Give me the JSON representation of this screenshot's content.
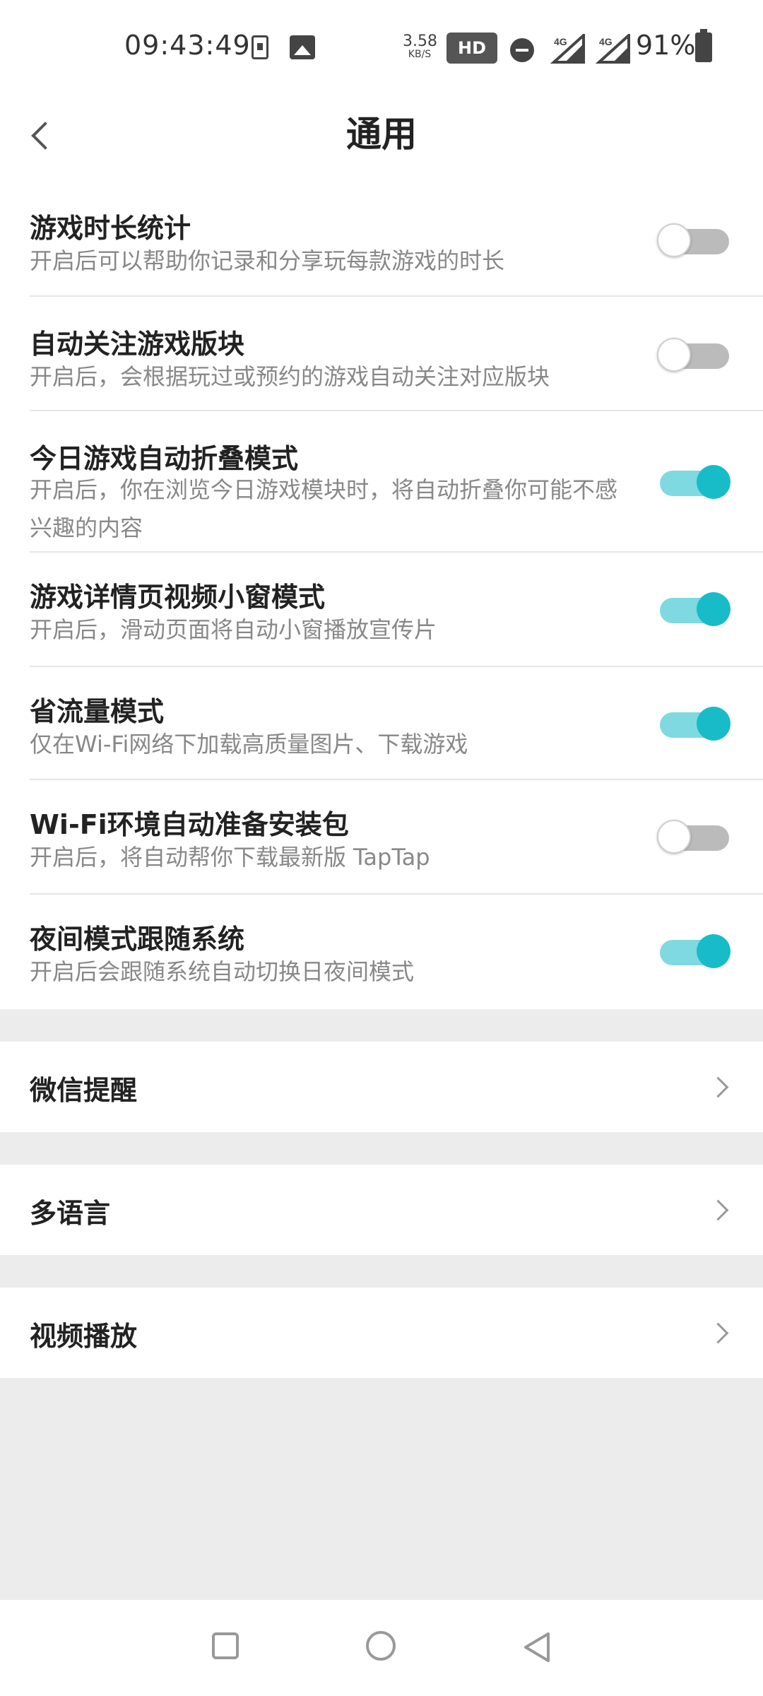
{
  "status_bar": {
    "time": "09:43:49",
    "speed_value": "3.58",
    "speed_unit": "KB/S",
    "hd_label": "HD",
    "network1": "4G",
    "network2": "4G",
    "battery": "91%",
    "icons": [
      "download-icon",
      "image-icon",
      "hd-icon",
      "dnd-icon",
      "signal-icon",
      "signal-icon",
      "battery-icon"
    ]
  },
  "header": {
    "title": "通用",
    "back_icon": "chevron-left-icon"
  },
  "toggles": [
    {
      "title": "游戏时长统计",
      "desc": "开启后可以帮助你记录和分享玩每款游戏的时长",
      "on": false
    },
    {
      "title": "自动关注游戏版块",
      "desc": "开启后，会根据玩过或预约的游戏自动关注对应版块",
      "on": false
    },
    {
      "title": "今日游戏自动折叠模式",
      "desc": "开启后，你在浏览今日游戏模块时，将自动折叠你可能不感兴趣的内容",
      "on": true
    },
    {
      "title": "游戏详情页视频小窗模式",
      "desc": "开启后，滑动页面将自动小窗播放宣传片",
      "on": true
    },
    {
      "title": "省流量模式",
      "desc": "仅在Wi-Fi网络下加载高质量图片、下载游戏",
      "on": true
    },
    {
      "title": "Wi-Fi环境自动准备安装包",
      "desc": "开启后，将自动帮你下载最新版 TapTap",
      "on": false
    },
    {
      "title": "夜间模式跟随系统",
      "desc": "开启后会跟随系统自动切换日夜间模式",
      "on": true
    }
  ],
  "nav_items": [
    {
      "label": "微信提醒"
    },
    {
      "label": "多语言"
    },
    {
      "label": "视频播放"
    }
  ],
  "colors": {
    "accent": "#17bcc8",
    "accent_track": "#7fd9e1",
    "off_track": "#bbbbbb",
    "section_bg": "#ececec"
  }
}
